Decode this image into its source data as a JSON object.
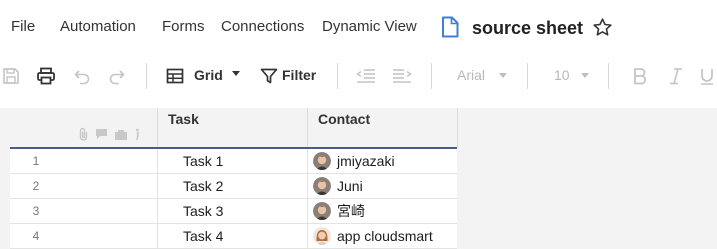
{
  "menu": {
    "items": [
      "File",
      "Automation",
      "Forms",
      "Connections",
      "Dynamic View"
    ],
    "sheet_title": "source sheet"
  },
  "toolbar": {
    "view_label": "Grid",
    "filter_label": "Filter",
    "font_name": "Arial",
    "font_size": "10"
  },
  "grid": {
    "columns": [
      "Task",
      "Contact"
    ],
    "rows": [
      {
        "num": "1",
        "task": "Task 1",
        "contact": "jmiyazaki",
        "avatar": "man-avatar"
      },
      {
        "num": "2",
        "task": "Task 2",
        "contact": "Juni",
        "avatar": "man-avatar"
      },
      {
        "num": "3",
        "task": "Task 3",
        "contact": "宮崎",
        "avatar": "man-avatar"
      },
      {
        "num": "4",
        "task": "Task 4",
        "contact": "app cloudsmart",
        "avatar": "woman-avatar"
      }
    ]
  },
  "colors": {
    "header_bg": "#f3f3f3",
    "accent_line": "#4a5a8b",
    "sheet_icon": "#3f7fd6"
  }
}
